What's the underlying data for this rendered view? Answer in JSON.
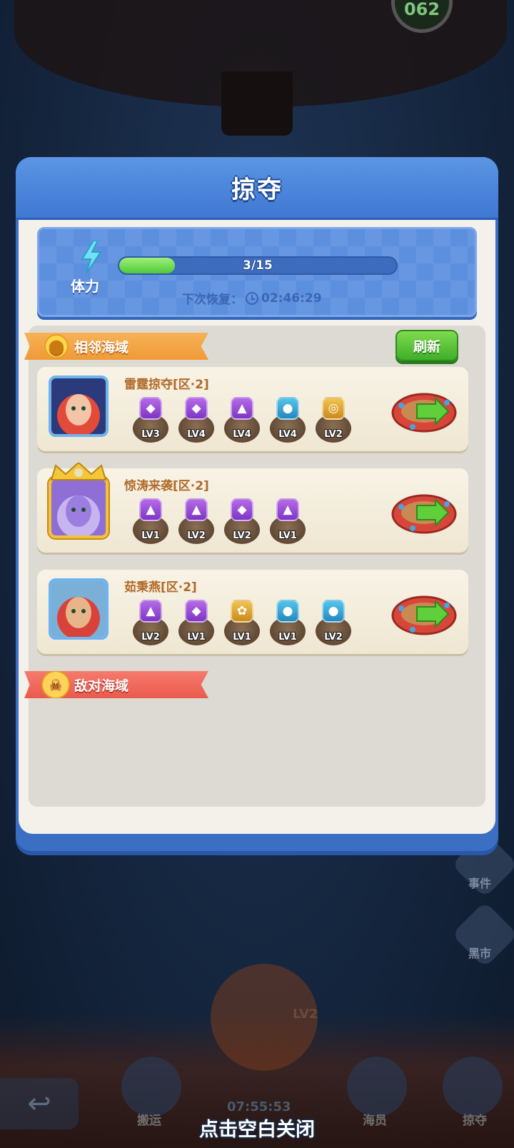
{
  "background": {
    "counter_text": "062",
    "side_buttons": [
      {
        "label": "事件",
        "icon": "event-icon"
      },
      {
        "label": "黑市",
        "icon": "shop-icon"
      }
    ],
    "wheel_level": "LV2",
    "timer": "07:55:53",
    "bottom_tabs": [
      {
        "label": "搬运"
      },
      {
        "label": "海员"
      },
      {
        "label": "掠夺"
      }
    ]
  },
  "modal": {
    "title": "掠夺",
    "stamina": {
      "label": "体力",
      "current": 3,
      "max": 15,
      "text": "3/15",
      "recover_label": "下次恢复：",
      "recover_time": "02:46:29"
    },
    "nearby": {
      "label": "相邻海域",
      "refresh_label": "刷新",
      "targets": [
        {
          "name": "雷霆掠夺[区·2]",
          "avatar": "red-hair-pirate-woman",
          "items": [
            {
              "lv": "LV3",
              "icon": "ore",
              "color": "purple"
            },
            {
              "lv": "LV4",
              "icon": "ore",
              "color": "purple"
            },
            {
              "lv": "LV4",
              "icon": "shell",
              "color": "purple"
            },
            {
              "lv": "LV4",
              "icon": "bomb",
              "color": "blue"
            },
            {
              "lv": "LV2",
              "icon": "coin",
              "color": "gold"
            }
          ]
        },
        {
          "name": "惊涛来袭[区·2]",
          "avatar": "purple-skin-girl-gold-frame",
          "items": [
            {
              "lv": "LV1",
              "icon": "shell",
              "color": "purple"
            },
            {
              "lv": "LV2",
              "icon": "shell",
              "color": "purple"
            },
            {
              "lv": "LV2",
              "icon": "ore",
              "color": "purple"
            },
            {
              "lv": "LV1",
              "icon": "shell",
              "color": "purple"
            }
          ]
        },
        {
          "name": "茹秉燕[区·2]",
          "avatar": "bearded-pirate-man",
          "items": [
            {
              "lv": "LV2",
              "icon": "shell",
              "color": "purple"
            },
            {
              "lv": "LV1",
              "icon": "ore",
              "color": "purple"
            },
            {
              "lv": "LV1",
              "icon": "herb",
              "color": "gold"
            },
            {
              "lv": "LV1",
              "icon": "bomb",
              "color": "blue"
            },
            {
              "lv": "LV2",
              "icon": "bomb",
              "color": "blue"
            }
          ]
        }
      ]
    },
    "hostile": {
      "label": "敌对海域"
    }
  },
  "close_hint": "点击空白关闭",
  "colors": {
    "header_blue": "#3f78d2",
    "progress_green": "#4fc83a",
    "ribbon_orange": "#f09a36",
    "ribbon_red": "#ea5a4c",
    "title_brown": "#b06a2a"
  }
}
